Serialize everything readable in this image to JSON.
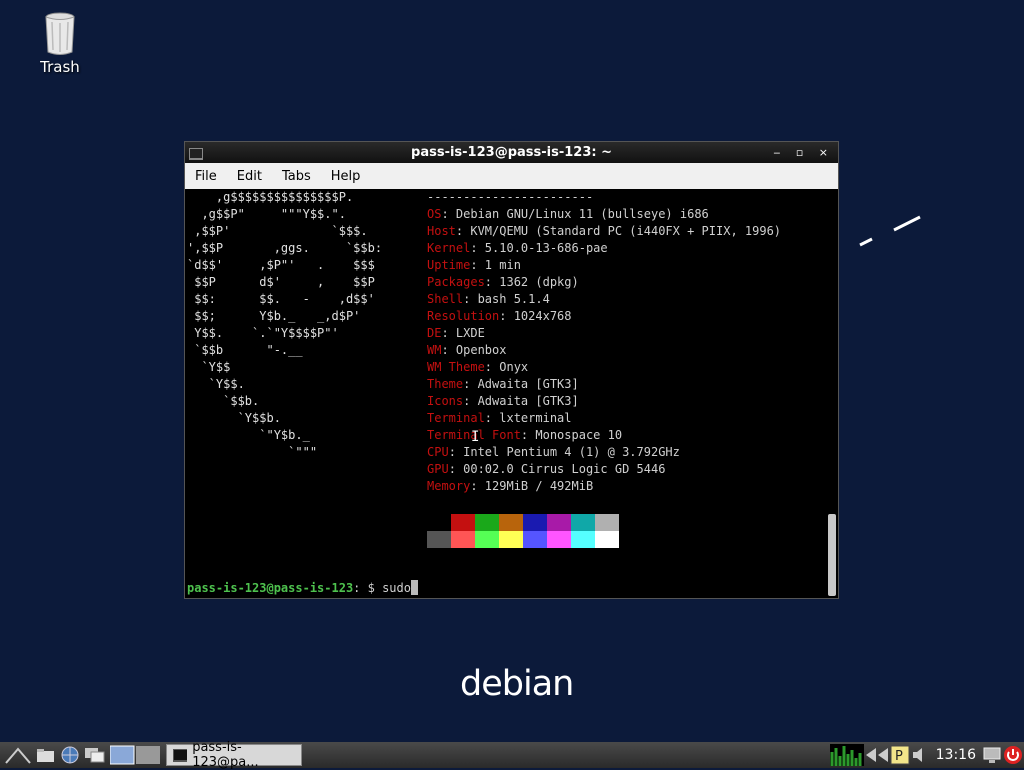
{
  "desktop": {
    "trash_label": "Trash",
    "logo_text": "debian"
  },
  "window": {
    "title": "pass-is-123@pass-is-123: ~",
    "buttons": "_ ▫ ×",
    "menu": [
      "File",
      "Edit",
      "Tabs",
      "Help"
    ]
  },
  "terminal": {
    "ascii": [
      "    ,g$$$$$$$$$$$$$$$P.",
      "  ,g$$P\"     \"\"\"Y$$.\".",
      " ,$$P'              `$$$.",
      "',$$P       ,ggs.     `$$b:",
      "`d$$'     ,$P\"'   .    $$$",
      " $$P      d$'     ,    $$P",
      " $$:      $$.   -    ,d$$'",
      " $$;      Y$b._   _,d$P'",
      " Y$$.    `.`\"Y$$$$P\"'",
      " `$$b      \"-.__",
      "  `Y$$",
      "   `Y$$.",
      "     `$$b.",
      "       `Y$$b.",
      "          `\"Y$b._",
      "              `\"\"\""
    ],
    "info_separator": "-----------------------",
    "info": [
      {
        "key": "OS",
        "value": "Debian GNU/Linux 11 (bullseye) i686"
      },
      {
        "key": "Host",
        "value": "KVM/QEMU (Standard PC (i440FX + PIIX, 1996)"
      },
      {
        "key": "Kernel",
        "value": "5.10.0-13-686-pae"
      },
      {
        "key": "Uptime",
        "value": "1 min"
      },
      {
        "key": "Packages",
        "value": "1362 (dpkg)"
      },
      {
        "key": "Shell",
        "value": "bash 5.1.4"
      },
      {
        "key": "Resolution",
        "value": "1024x768"
      },
      {
        "key": "DE",
        "value": "LXDE"
      },
      {
        "key": "WM",
        "value": "Openbox"
      },
      {
        "key": "WM Theme",
        "value": "Onyx"
      },
      {
        "key": "Theme",
        "value": "Adwaita [GTK3]"
      },
      {
        "key": "Icons",
        "value": "Adwaita [GTK3]"
      },
      {
        "key": "Terminal",
        "value": "lxterminal"
      },
      {
        "key": "Terminal Font",
        "value": "Monospace 10"
      },
      {
        "key": "CPU",
        "value": "Intel Pentium 4 (1) @ 3.792GHz"
      },
      {
        "key": "GPU",
        "value": "00:02.0 Cirrus Logic GD 5446"
      },
      {
        "key": "Memory",
        "value": "129MiB / 492MiB"
      }
    ],
    "palette_dark": [
      "#000000",
      "#c41010",
      "#1aa81a",
      "#b8640c",
      "#1a1ab0",
      "#a81aa8",
      "#10a8a8",
      "#b0b0b0"
    ],
    "palette_bright": [
      "#555555",
      "#ff5555",
      "#55ff55",
      "#ffff55",
      "#5555ff",
      "#ff55ff",
      "#55ffff",
      "#ffffff"
    ],
    "prompt_user": "pass-is-123@pass-is-123",
    "prompt_sep": ": $ ",
    "command": "sudo"
  },
  "taskbar": {
    "task_label": "pass-is-123@pa...",
    "clock": "13:16"
  }
}
